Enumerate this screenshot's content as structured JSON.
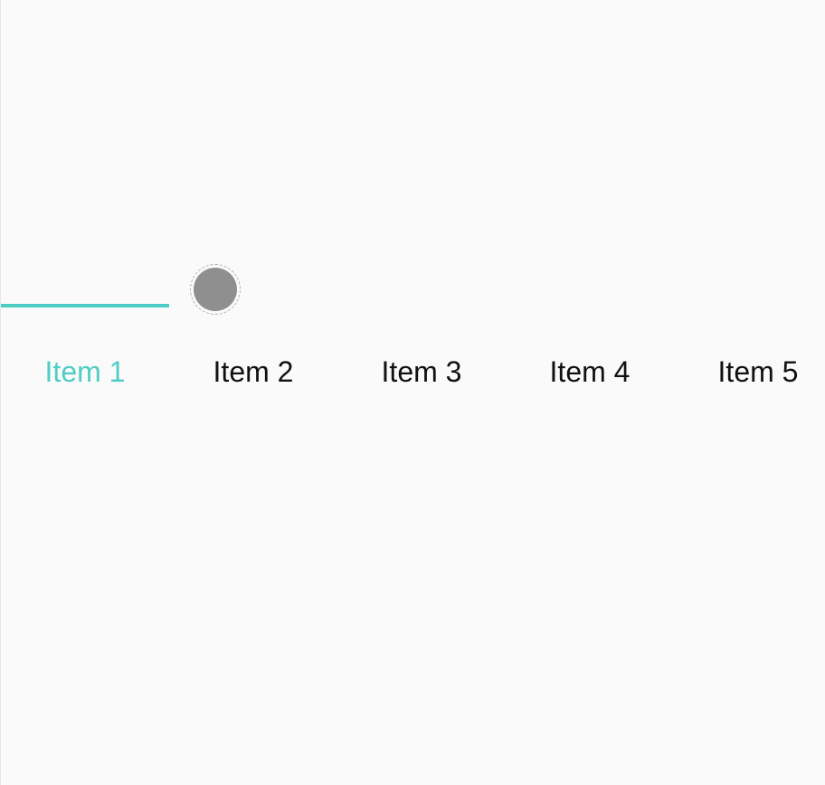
{
  "colors": {
    "accent": "#4ecdc4",
    "text": "#111111",
    "background": "#fafafa",
    "handle": "#8f8f8f"
  },
  "slider": {
    "handle_icon": "circle-knob",
    "selected_index": 0
  },
  "items": [
    {
      "label": "Item 1",
      "active": true
    },
    {
      "label": "Item 2",
      "active": false
    },
    {
      "label": "Item 3",
      "active": false
    },
    {
      "label": "Item 4",
      "active": false
    },
    {
      "label": "Item 5",
      "active": false
    }
  ]
}
